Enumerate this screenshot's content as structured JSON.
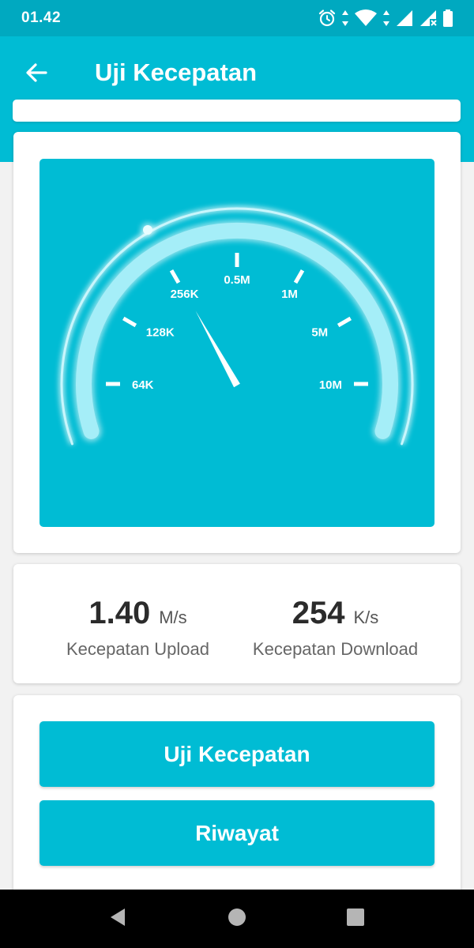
{
  "status_bar": {
    "time": "01.42",
    "icons": [
      "alarm-icon",
      "data-arrows-icon",
      "wifi-icon",
      "signal-icon",
      "signal-no-sim-icon",
      "battery-icon"
    ]
  },
  "app_bar": {
    "title": "Uji Kecepatan",
    "back_icon": "arrow-left-icon"
  },
  "gauge": {
    "tick_labels": [
      "64K",
      "128K",
      "256K",
      "0.5M",
      "1M",
      "5M",
      "10M"
    ],
    "needle_reading": "256K",
    "colors": {
      "panel": "#00bcd4",
      "arc": "#a5eef8",
      "glow": "#c8f6fc"
    }
  },
  "speeds": {
    "upload": {
      "value": "1.40",
      "unit": "M/s",
      "label": "Kecepatan Upload"
    },
    "download": {
      "value": "254",
      "unit": "K/s",
      "label": "Kecepatan Download"
    }
  },
  "buttons": {
    "test_label": "Uji Kecepatan",
    "history_label": "Riwayat"
  },
  "nav_bar": {
    "icons": [
      "nav-back-icon",
      "nav-home-icon",
      "nav-recents-icon"
    ]
  },
  "colors": {
    "accent": "#00bcd4",
    "status_bar": "#00a9c0",
    "nav_bar": "#000000",
    "background": "#f2f2f2"
  }
}
